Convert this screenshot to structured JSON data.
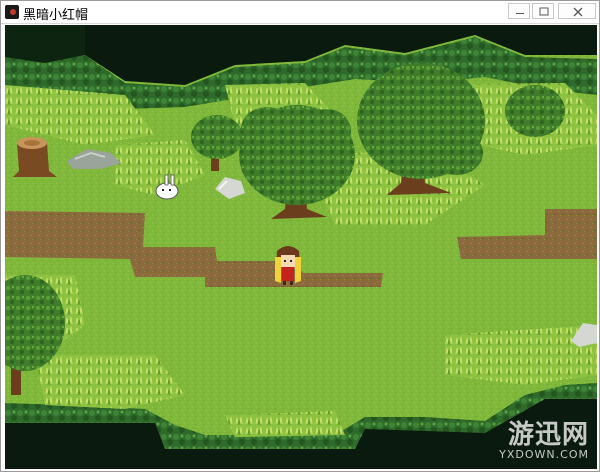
{
  "window": {
    "title": "黑暗小红帽"
  },
  "watermark": {
    "main": "游迅网",
    "sub": "YXDOWN.COM"
  },
  "icons": [
    "app-icon",
    "minimize-icon",
    "maximize-icon",
    "close-icon"
  ]
}
